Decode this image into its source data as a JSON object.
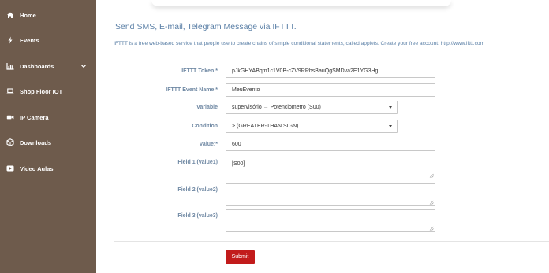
{
  "sidebar": {
    "items": [
      {
        "label": "Home",
        "icon": "home-icon"
      },
      {
        "label": "Events",
        "icon": "bolt-icon"
      },
      {
        "label": "Dashboards",
        "icon": "bar-chart-icon"
      },
      {
        "label": "Shop Floor IOT",
        "icon": "laptop-icon"
      },
      {
        "label": "IP Camera",
        "icon": "video-camera-icon"
      },
      {
        "label": "Downloads",
        "icon": "cube-icon"
      },
      {
        "label": "Video Aulas",
        "icon": "play-icon"
      }
    ]
  },
  "page": {
    "title": "Send SMS, E-mail, Telegram Message via IFTTT.",
    "intro": "IFTTT is a free web-based service that people use to create chains of simple conditional statements, called applets. Create your free account: http://www.ifttt.com"
  },
  "form": {
    "token_label": "IFTTT Token *",
    "token_value": "pJkGHYABqm1c1V0B-cZV9RRhsBauQgSMDva2E1YG3Hg",
    "event_label": "IFTTT Event Name *",
    "event_value": "MeuEvento",
    "variable_label": "Variable",
    "variable_value": "supervisório → Potenciometro (S00)",
    "condition_label": "Condition",
    "condition_value": "> (GREATER-THAN SIGN)",
    "value_label": "Value:*",
    "value_value": "600",
    "field1_label": "Field 1 (value1)",
    "field1_value": "[S00]",
    "field2_label": "Field 2 (value2)",
    "field2_value": "",
    "field3_label": "Field 3 (value3)",
    "field3_value": "",
    "submit_label": "Submit"
  },
  "colors": {
    "sidebar_bg": "#6e5b4c",
    "label_color": "#6f88a3",
    "title_color": "#5a7fa6",
    "submit_bg": "#c21b1b"
  }
}
